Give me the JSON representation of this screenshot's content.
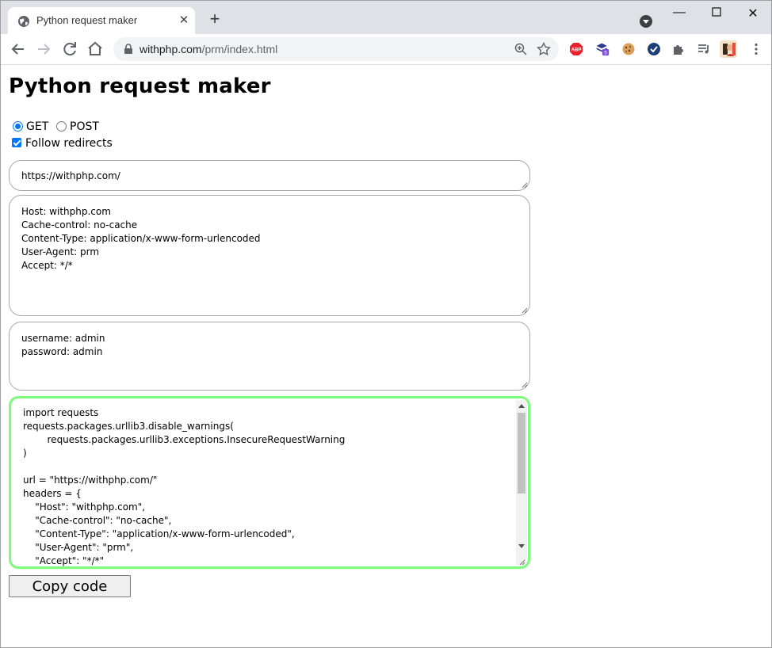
{
  "browser": {
    "tab_title": "Python request maker",
    "url_host": "withphp.com",
    "url_path": "/prm/index.html"
  },
  "page": {
    "title": "Python request maker",
    "method_get": "GET",
    "method_post": "POST",
    "method_selected": "GET",
    "follow_redirects_label": "Follow redirects",
    "follow_redirects_checked": true,
    "url_value": "https://withphp.com/",
    "headers_lines": [
      "Host: withphp.com",
      "Cache-control: no-cache",
      "Content-Type: application/x-www-form-urlencoded",
      "User-Agent: prm",
      "Accept: */*"
    ],
    "params_lines": [
      "username: admin",
      "password: admin"
    ],
    "code_lines": [
      "import requests",
      "requests.packages.urllib3.disable_warnings(",
      "        requests.packages.urllib3.exceptions.InsecureRequestWarning",
      ")",
      "",
      "url = \"https://withphp.com/\"",
      "headers = {",
      "    \"Host\": \"withphp.com\",",
      "    \"Cache-control\": \"no-cache\",",
      "    \"Content-Type\": \"application/x-www-form-urlencoded\",",
      "    \"User-Agent\": \"prm\",",
      "    \"Accept\": \"*/*\""
    ],
    "copy_button": "Copy code"
  },
  "colors": {
    "code_border": "#7dfb7a",
    "radio_accent": "#0075ff"
  }
}
